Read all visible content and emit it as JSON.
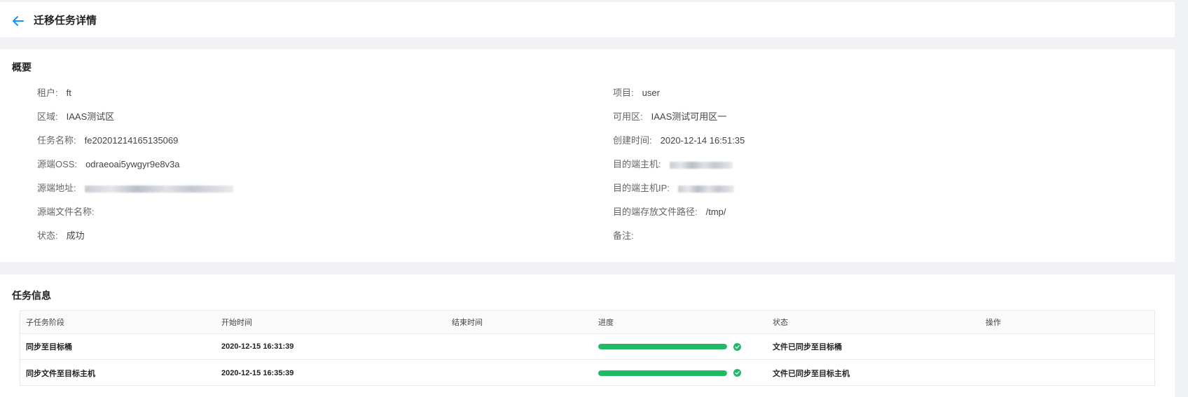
{
  "header": {
    "title": "迁移任务详情"
  },
  "overview": {
    "title": "概要",
    "left": [
      {
        "label": "租户:",
        "value": "ft"
      },
      {
        "label": "区域:",
        "value": "IAAS测试区"
      },
      {
        "label": "任务名称:",
        "value": "fe20201214165135069"
      },
      {
        "label": "源端OSS:",
        "value": "odraeoai5ywgyr9e8v3a"
      },
      {
        "label": "源端地址:",
        "value": ""
      },
      {
        "label": "源端文件名称:",
        "value": ""
      },
      {
        "label": "状态:",
        "value": "成功"
      }
    ],
    "right": [
      {
        "label": "项目:",
        "value": "user"
      },
      {
        "label": "可用区:",
        "value": "IAAS测试可用区一"
      },
      {
        "label": "创建时间:",
        "value": "2020-12-14 16:51:35"
      },
      {
        "label": "目的端主机:",
        "value": ""
      },
      {
        "label": "目的端主机IP:",
        "value": ""
      },
      {
        "label": "目的端存放文件路径:",
        "value": "/tmp/"
      },
      {
        "label": "备注:",
        "value": ""
      }
    ]
  },
  "task_info": {
    "title": "任务信息",
    "columns": [
      "子任务阶段",
      "开始时间",
      "结束时间",
      "进度",
      "状态",
      "操作"
    ],
    "rows": [
      {
        "stage": "同步至目标桶",
        "start": "2020-12-15 16:31:39",
        "end": "",
        "progress": 1.0,
        "status": "文件已同步至目标桶"
      },
      {
        "stage": "同步文件至目标主机",
        "start": "2020-12-15 16:35:39",
        "end": "",
        "progress": 1.0,
        "status": "文件已同步至目标主机"
      }
    ]
  },
  "colors": {
    "accent": "#1890ff",
    "success": "#1fba66"
  },
  "icons": {
    "back": "arrow-left-icon",
    "check": "check-circle-icon"
  }
}
